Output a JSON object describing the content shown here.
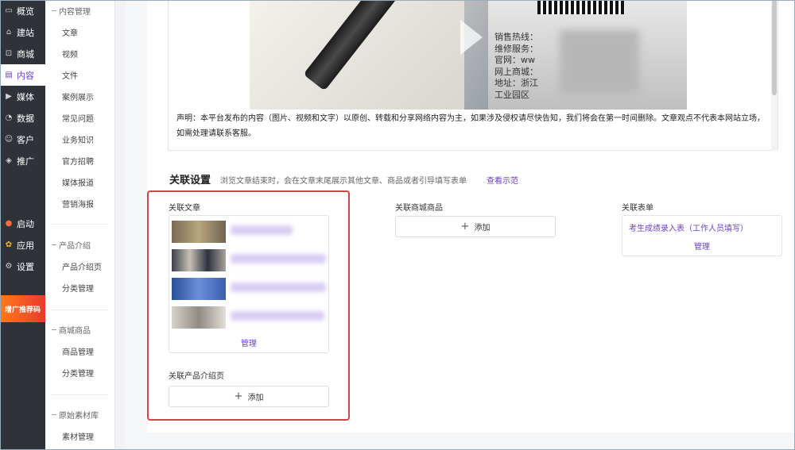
{
  "nav": {
    "items": [
      {
        "label": "概览",
        "icon": "monitor-icon",
        "active": false
      },
      {
        "label": "建站",
        "icon": "home-icon",
        "active": false
      },
      {
        "label": "商城",
        "icon": "shop-icon",
        "active": false
      },
      {
        "label": "内容",
        "icon": "document-icon",
        "active": true
      },
      {
        "label": "媒体",
        "icon": "play-icon",
        "active": false
      },
      {
        "label": "数据",
        "icon": "chart-icon",
        "active": false
      },
      {
        "label": "客户",
        "icon": "user-icon",
        "active": false
      },
      {
        "label": "推广",
        "icon": "tag-icon",
        "active": false
      }
    ],
    "lower_items": [
      {
        "label": "启动",
        "icon": "rocket-icon"
      },
      {
        "label": "应用",
        "icon": "apps-icon"
      },
      {
        "label": "设置",
        "icon": "gear-icon"
      }
    ],
    "promo_label": "增广推荐码"
  },
  "subnav": {
    "content": {
      "title": "内容管理",
      "items": [
        "文章",
        "视频",
        "文件",
        "案例展示",
        "常见问题",
        "业务知识",
        "官方招聘",
        "媒体报道",
        "营销海报"
      ]
    },
    "product": {
      "title": "产品介绍",
      "items": [
        "产品介绍页",
        "分类管理"
      ]
    },
    "mall": {
      "title": "商城商品",
      "items": [
        "商品管理",
        "分类管理"
      ]
    },
    "material": {
      "title": "原始素材库",
      "items": [
        "素材管理"
      ]
    }
  },
  "article": {
    "card_lines": "销售热线：\n维修服务：\n官网：ww\n网上商城：\n地址：浙江\n工业园区",
    "statement": "声明：本平台发布的内容（图片、视频和文字）以原创、转载和分享网络内容为主，如果涉及侵权请尽快告知，我们将会在第一时间删除。文章观点不代表本网站立场，如需处理请联系客服。"
  },
  "related": {
    "title": "关联设置",
    "hint": "浏览文章结束时，会在文章末尾展示其他文章、商品或者引导填写表单",
    "example_link": "查看示范",
    "articles_label": "关联文章",
    "articles_manage": "管理",
    "products_page_label": "关联产品介绍页",
    "products_page_add": "添加",
    "mall_label": "关联商城商品",
    "mall_add": "添加",
    "form_label": "关联表单",
    "form_name": "考生成绩录入表（工作人员填写）",
    "form_manage": "管理"
  }
}
